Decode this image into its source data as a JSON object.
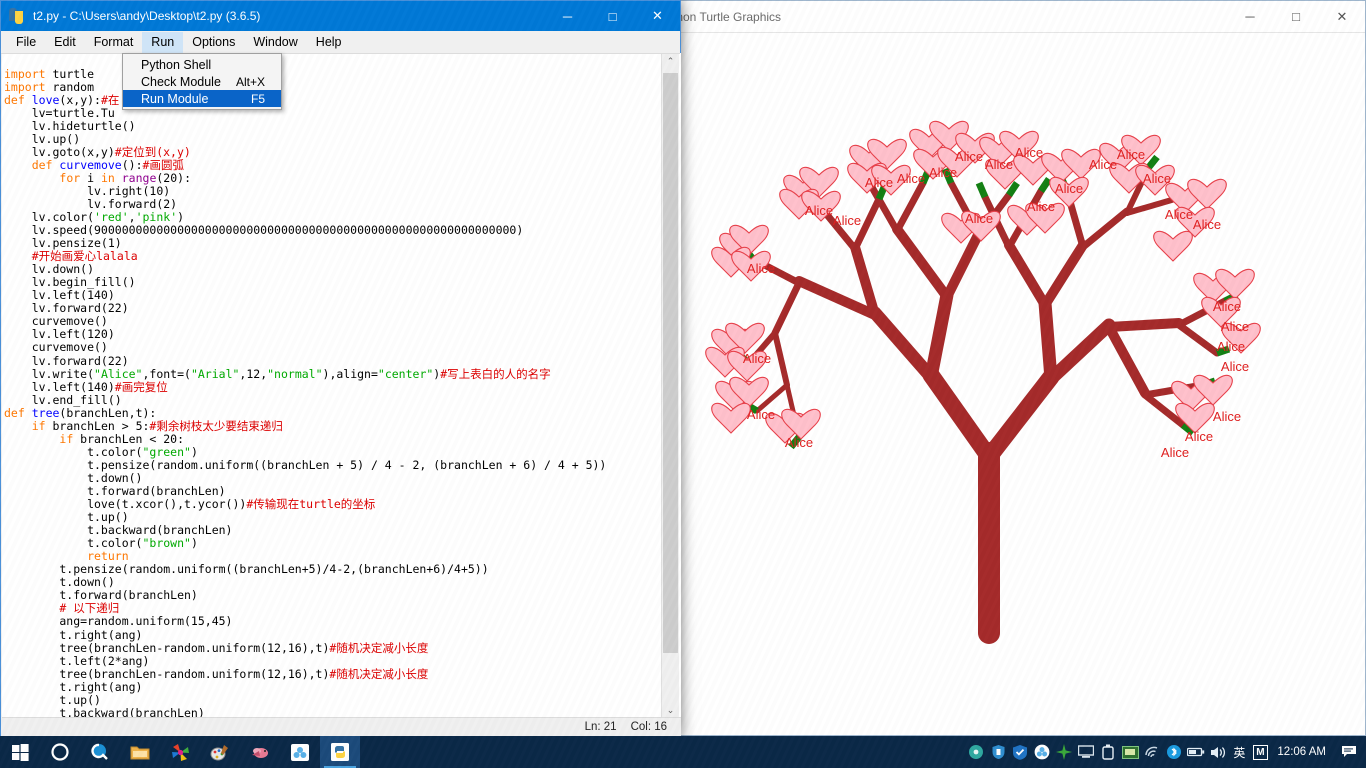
{
  "idle": {
    "title": "t2.py - C:\\Users\\andy\\Desktop\\t2.py (3.6.5)",
    "icon": "python-icon",
    "window_buttons": {
      "minimize": "─",
      "maximize": "□",
      "close": "✕"
    },
    "menus": [
      {
        "label": "File",
        "name": "menu-file"
      },
      {
        "label": "Edit",
        "name": "menu-edit"
      },
      {
        "label": "Format",
        "name": "menu-format"
      },
      {
        "label": "Run",
        "name": "menu-run",
        "active": true
      },
      {
        "label": "Options",
        "name": "menu-options"
      },
      {
        "label": "Window",
        "name": "menu-window"
      },
      {
        "label": "Help",
        "name": "menu-help"
      }
    ],
    "run_menu": [
      {
        "label": "Python Shell",
        "accel": "",
        "selected": false
      },
      {
        "label": "Check Module",
        "accel": "Alt+X",
        "selected": false
      },
      {
        "label": "Run Module",
        "accel": "F5",
        "selected": true
      }
    ],
    "status": {
      "line": "Ln: 21",
      "col": "Col: 16"
    },
    "scrollbar": {
      "up": "⌃",
      "down": "⌄"
    },
    "code": "import turtle\nimport random\ndef love(x,y):#在\nlv=turtle.Tu\nlv.hideturtle()\nlv.up()\nlv.goto(x,y)#定位到(x,y)\n    def curvemove():#画圆弧\n        for i in range(20):\n            lv.right(10)\n            lv.forward(2)\nlv.color('red','pink')\nlv.speed(9000000000)\nlv.pensize(1)\n#开始画爱心lalala\nlv.down()\nlv.begin_fill()\nlv.left(140)\nlv.forward(22)\ncurvemove()\nlv.left(120)\ncurvemove()\nlv.forward(22)\nlv.write(\"Alice\",font=(\"Arial\",12,\"normal\"),align=\"center\")#写上表白的人的名字\nlv.left(140)#画完复位\nlv.end_fill()\ndef tree(branchLen,t):\n    if branchLen > 5:#剩余树枝太少要结束递归\n        if branchLen < 20:\n            t.color(\"green\")\n            t.pensize(random.uniform((branchLen + 5) / 4 - 2, (branchLen + 6) / 4 + 5))\n            t.down()\n            t.forward(branchLen)\n            love(t.xcor(),t.ycor())#传输现在turtle的坐标\n            t.up()\n            t.backward(branchLen)\n            t.color(\"brown\")\n            return\n        t.pensize(random.uniform((branchLen+5)/4-2,(branchLen+6)/4+5))\n        t.down()\n        t.forward(branchLen)\n        # 以下递归\n        ang=random.uniform(15,45)\n        t.right(ang)\n        tree(branchLen-random.uniform(12,16),t)#随机决定减小长度\n        t.left(2*ang)\n        tree(branchLen-random.uniform(12,16),t)#随机决定减小长度\n        t.right(ang)\n        t.up()\n        t.backward(branchLen)\nmyWin = turtle.Screen()"
  },
  "turtle_window": {
    "title": "thon Turtle Graphics",
    "full_title": "Python Turtle Graphics",
    "window_buttons": {
      "minimize": "─",
      "maximize": "□",
      "close": "✕"
    },
    "drawing": {
      "label_text": "Alice",
      "branch_color": "#a52a2a",
      "twig_color": "#138013",
      "heart_fill": "#ffc0cb",
      "heart_outline": "#e8404a",
      "label_color": "#e02020",
      "background": "#ffffff"
    }
  },
  "taskbar": {
    "background": "#0a2847",
    "start": "start-icon",
    "apps": [
      {
        "name": "taskbar-start",
        "icon": "windows-logo"
      },
      {
        "name": "taskbar-cortana",
        "icon": "cortana-circle-icon"
      },
      {
        "name": "taskbar-search",
        "icon": "search-icon"
      },
      {
        "name": "taskbar-file-explorer",
        "icon": "folder-icon"
      },
      {
        "name": "taskbar-app-colors",
        "icon": "pinwheel-icon"
      },
      {
        "name": "taskbar-app-paint",
        "icon": "paint-icon"
      },
      {
        "name": "taskbar-app-bird",
        "icon": "bird-icon"
      },
      {
        "name": "taskbar-app-cloud",
        "icon": "cloud-icon"
      },
      {
        "name": "taskbar-python-idle",
        "icon": "python-icon",
        "active": true
      }
    ],
    "tray": [
      {
        "name": "tray-media-icon",
        "icon": "disc-icon"
      },
      {
        "name": "tray-antivirus-icon",
        "icon": "shield-blue-icon"
      },
      {
        "name": "tray-security-icon",
        "icon": "shield-icon"
      },
      {
        "name": "tray-cloud-icon",
        "icon": "cloud-icon"
      },
      {
        "name": "tray-network-green-icon",
        "icon": "compass-icon"
      },
      {
        "name": "tray-display-icon",
        "icon": "monitor-icon"
      },
      {
        "name": "tray-usb-icon",
        "icon": "usb-icon"
      },
      {
        "name": "tray-graphics-icon",
        "icon": "chip-icon"
      },
      {
        "name": "tray-wifi-icon",
        "icon": "wifi-icon"
      },
      {
        "name": "tray-bluetooth-icon",
        "icon": "bluetooth-icon"
      },
      {
        "name": "tray-battery-icon",
        "icon": "battery-icon"
      },
      {
        "name": "tray-volume-icon",
        "icon": "speaker-icon"
      }
    ],
    "ime_label": "英",
    "ime_mode": "M",
    "clock": "12:06 AM",
    "action_center": "notification-icon"
  }
}
